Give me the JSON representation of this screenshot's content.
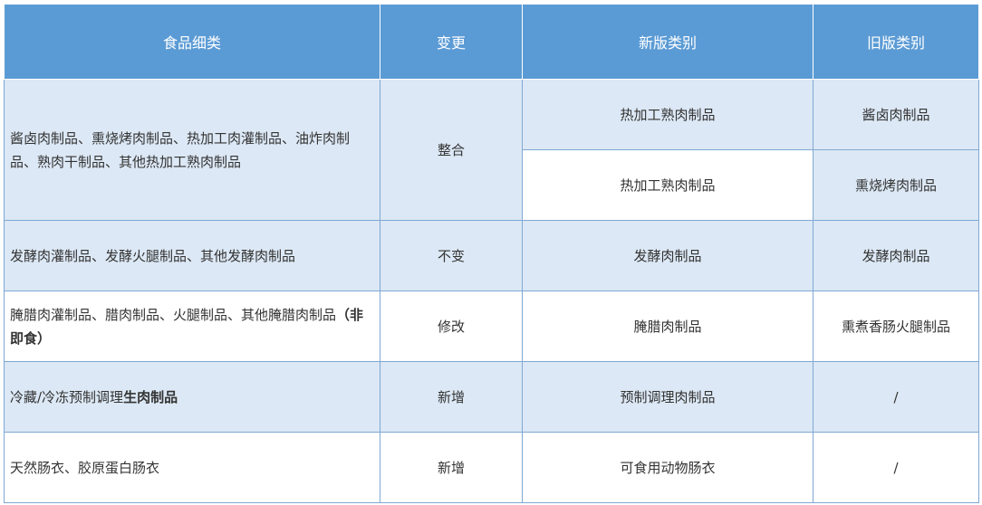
{
  "table": {
    "headers": {
      "old": "旧版类别",
      "new": "新版类别",
      "change": "变更",
      "detail": "食品细类"
    },
    "rows": [
      {
        "old": "酱卤肉制品",
        "new": "热加工熟肉制品",
        "change": "整合",
        "detail": "酱卤肉制品、熏烧烤肉制品、热加工肉灌制品、油炸肉制品、熟肉干制品、其他热加工熟肉制品"
      },
      {
        "old": "熏烧烤肉制品",
        "new": "热加工熟肉制品"
      },
      {
        "old": "发酵肉制品",
        "new": "发酵肉制品",
        "change": "不变",
        "detail": "发酵肉灌制品、发酵火腿制品、其他发酵肉制品"
      },
      {
        "old": "熏煮香肠火腿制品",
        "new": "腌腊肉制品",
        "change": "修改",
        "detail": "腌腊肉灌制品、腊肉制品、火腿制品、其他腌腊肉制品",
        "detail_bold": "（非即食）"
      },
      {
        "old": "/",
        "new": "预制调理肉制品",
        "change": "新增",
        "detail": "冷藏/冷冻预制调理",
        "detail_bold": "生肉制品"
      },
      {
        "old": "/",
        "new": "可食用动物肠衣",
        "change": "新增",
        "detail": "天然肠衣、胶原蛋白肠衣"
      }
    ]
  }
}
